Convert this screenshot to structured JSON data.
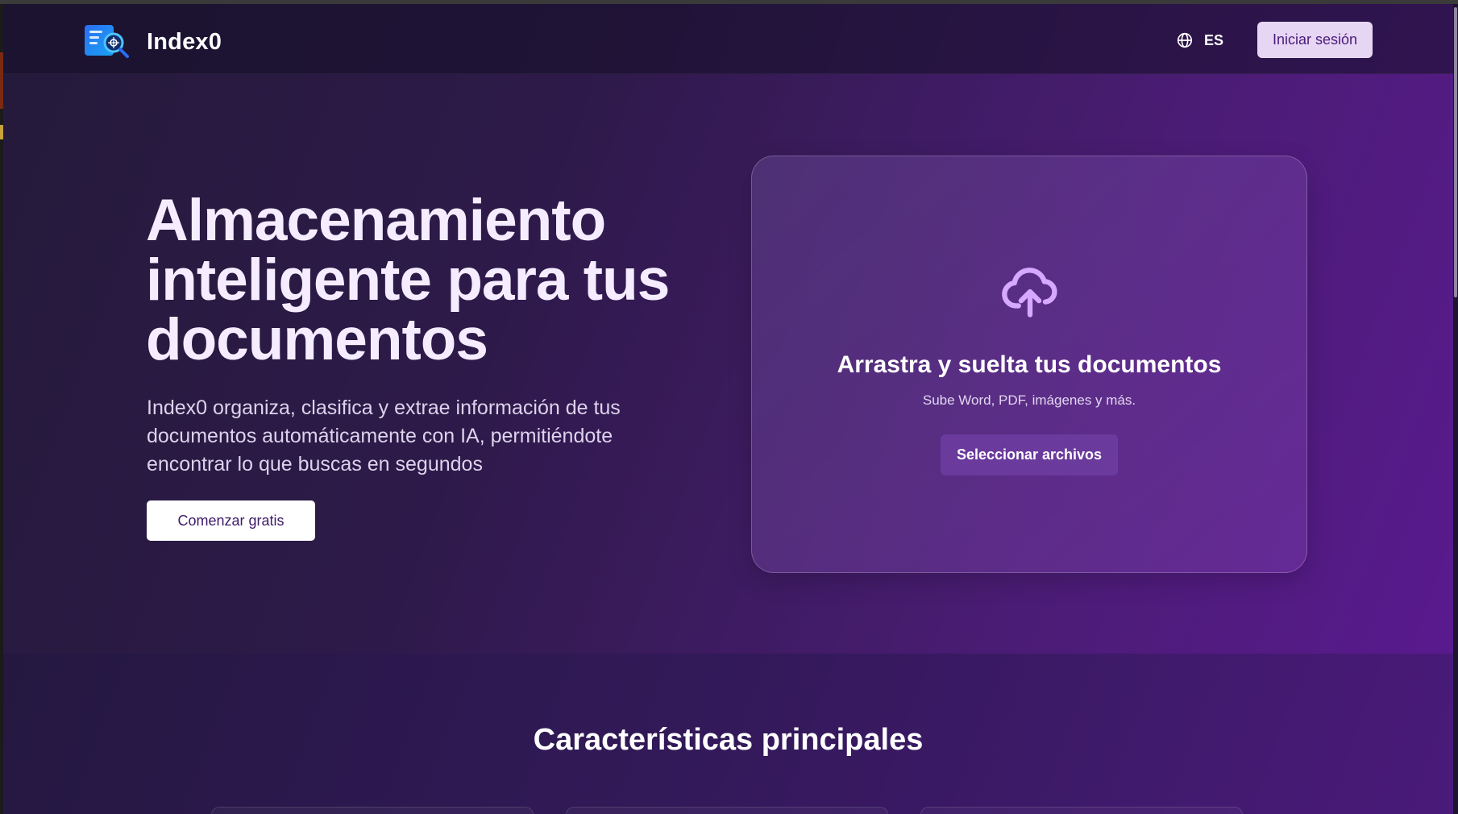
{
  "header": {
    "brand": "Index0",
    "language": "ES",
    "login_label": "Iniciar sesión"
  },
  "hero": {
    "title": "Almacenamiento inteligente para tus documentos",
    "description": "Index0 organiza, clasifica y extrae información de tus documentos automáticamente con IA, permitiéndote encontrar lo que buscas en segundos",
    "cta_label": "Comenzar gratis"
  },
  "upload": {
    "icon": "cloud-upload-icon",
    "title": "Arrastra y suelta tus documentos",
    "subtitle": "Sube Word, PDF, imágenes y más.",
    "button_label": "Seleccionar archivos"
  },
  "features": {
    "title": "Características principales"
  },
  "colors": {
    "accent": "#6a3a9c",
    "login_bg": "#e6d6f4",
    "hero_gradient_end": "#5b1a91"
  }
}
